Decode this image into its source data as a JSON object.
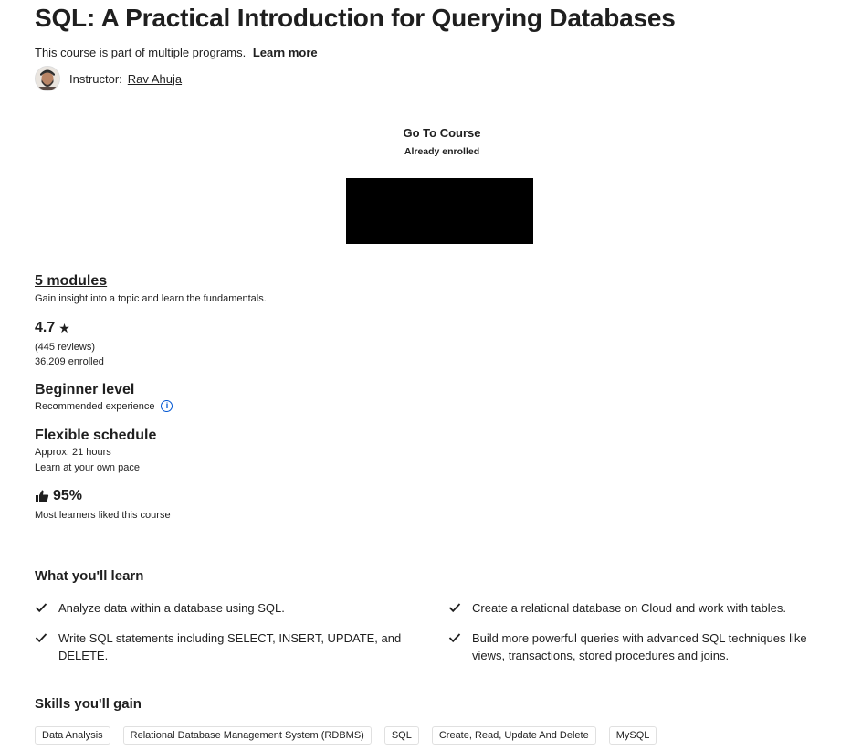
{
  "course": {
    "title": "SQL: A Practical Introduction for Querying Databases",
    "part_of_text": "This course is part of multiple programs.",
    "learn_more_label": "Learn more",
    "instructor_label": "Instructor:",
    "instructor_name": "Rav Ahuja"
  },
  "enroll": {
    "go_to_course_label": "Go To Course",
    "status_text": "Already enrolled"
  },
  "stats": {
    "modules_label": "5 modules",
    "modules_desc": "Gain insight into a topic and learn the fundamentals.",
    "rating_value": "4.7",
    "rating_star": "★",
    "reviews_text": "(445 reviews)",
    "enrolled_text": "36,209 enrolled",
    "level_title": "Beginner level",
    "level_desc": "Recommended experience",
    "info_icon_glyph": "i",
    "schedule_title": "Flexible schedule",
    "schedule_hours": "Approx. 21 hours",
    "schedule_pace": "Learn at your own pace",
    "liked_percent": "95%",
    "liked_desc": "Most learners liked this course"
  },
  "learn": {
    "title": "What you'll learn",
    "items": [
      "Analyze data within a database using SQL.",
      "Create a relational database on Cloud and work with tables.",
      "Write SQL statements including SELECT, INSERT, UPDATE, and DELETE.",
      "Build more powerful queries with advanced SQL techniques like views, transactions, stored procedures and joins."
    ]
  },
  "skills": {
    "title": "Skills you'll gain",
    "tags": [
      "Data Analysis",
      "Relational Database Management System (RDBMS)",
      "SQL",
      "Create, Read, Update And Delete",
      "MySQL"
    ]
  }
}
